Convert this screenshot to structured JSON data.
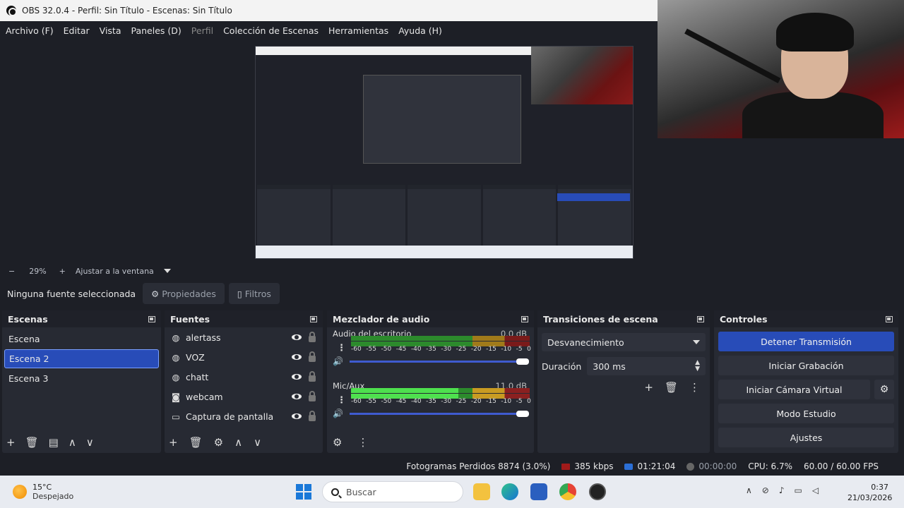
{
  "window": {
    "title": "OBS 32.0.4 - Perfil: Sin Título - Escenas: Sin Título"
  },
  "menu": [
    {
      "label": "Archivo (F)",
      "disabled": false
    },
    {
      "label": "Editar",
      "disabled": false
    },
    {
      "label": "Vista",
      "disabled": false
    },
    {
      "label": "Paneles (D)",
      "disabled": false
    },
    {
      "label": "Perfil",
      "disabled": true
    },
    {
      "label": "Colección de Escenas",
      "disabled": false
    },
    {
      "label": "Herramientas",
      "disabled": false
    },
    {
      "label": "Ayuda (H)",
      "disabled": false
    }
  ],
  "zoom": {
    "minus": "−",
    "level": "29%",
    "plus": "+",
    "fit_label": "Ajustar a la ventana"
  },
  "source_toolbar": {
    "no_selection": "Ninguna fuente seleccionada",
    "properties": "Propiedades",
    "filters": "Filtros"
  },
  "scenes": {
    "title": "Escenas",
    "items": [
      "Escena",
      "Escena 2",
      "Escena 3"
    ],
    "selected_index": 1
  },
  "sources": {
    "title": "Fuentes",
    "items": [
      {
        "label": "alertass",
        "icon": "globe-icon"
      },
      {
        "label": "VOZ",
        "icon": "globe-icon"
      },
      {
        "label": "chatt",
        "icon": "globe-icon"
      },
      {
        "label": "webcam",
        "icon": "camera-icon"
      },
      {
        "label": "Captura de pantalla",
        "icon": "monitor-icon"
      }
    ]
  },
  "mixer": {
    "title": "Mezclador de audio",
    "scale": [
      "-60",
      "-55",
      "-50",
      "-45",
      "-40",
      "-35",
      "-30",
      "-25",
      "-20",
      "-15",
      "-10",
      "-5",
      "0"
    ],
    "channels": [
      {
        "name": "Audio del escritorio",
        "db": "0.0 dB",
        "level": 0.0,
        "volume": 1.0
      },
      {
        "name": "Mic/Aux",
        "db": "11.0 dB",
        "level": 0.82,
        "volume": 1.0
      }
    ]
  },
  "transitions": {
    "title": "Transiciones de escena",
    "selected": "Desvanecimiento",
    "duration_label": "Duración",
    "duration_value": "300 ms"
  },
  "controls": {
    "title": "Controles",
    "stop_stream": "Detener Transmisión",
    "start_recording": "Iniciar Grabación",
    "start_virtual_cam": "Iniciar Cámara Virtual",
    "studio_mode": "Modo Estudio",
    "settings": "Ajustes"
  },
  "status": {
    "dropped_frames": "Fotogramas Perdidos 8874 (3.0%)",
    "bitrate": "385 kbps",
    "stream_time": "01:21:04",
    "rec_time": "00:00:00",
    "cpu": "CPU: 6.7%",
    "fps": "60.00 / 60.00 FPS"
  },
  "taskbar": {
    "weather_temp": "15°C",
    "weather_desc": "Despejado",
    "search_placeholder": "Buscar",
    "time": "0:37",
    "date": "21/03/2026"
  },
  "colors": {
    "accent": "#284cb8",
    "meter_green": "#4ee04e",
    "meter_yellow": "#c89b22",
    "meter_red": "#8a2020"
  }
}
